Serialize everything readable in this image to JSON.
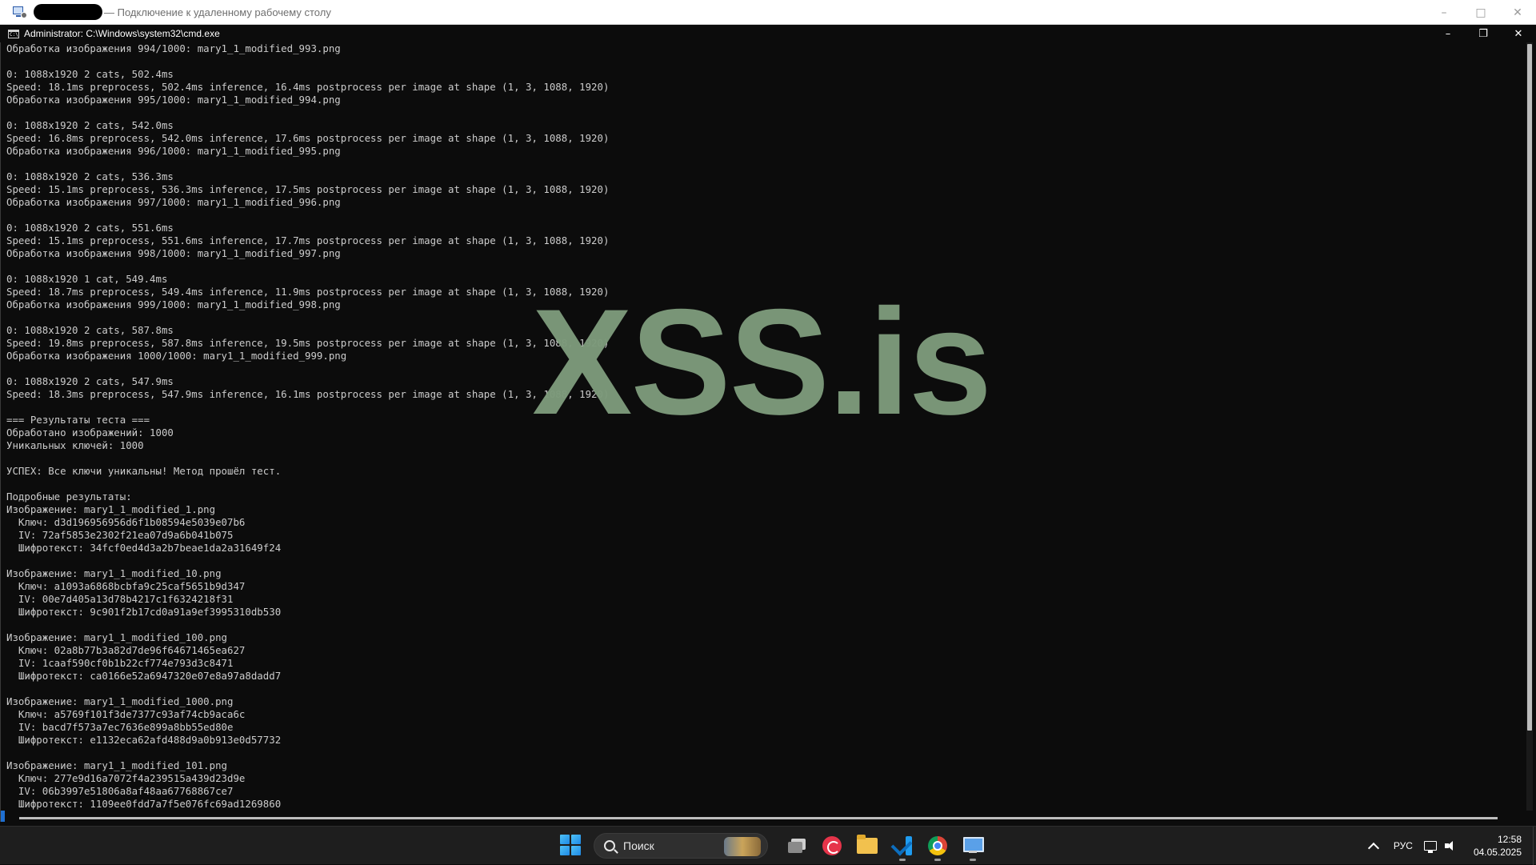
{
  "rdp_window": {
    "title": "— Подключение к удаленному рабочему столу"
  },
  "cmd_window": {
    "title": "Administrator: C:\\Windows\\system32\\cmd.exe"
  },
  "console": {
    "lines": [
      "Обработка изображения 994/1000: mary1_1_modified_993.png",
      "",
      "0: 1088x1920 2 cats, 502.4ms",
      "Speed: 18.1ms preprocess, 502.4ms inference, 16.4ms postprocess per image at shape (1, 3, 1088, 1920)",
      "Обработка изображения 995/1000: mary1_1_modified_994.png",
      "",
      "0: 1088x1920 2 cats, 542.0ms",
      "Speed: 16.8ms preprocess, 542.0ms inference, 17.6ms postprocess per image at shape (1, 3, 1088, 1920)",
      "Обработка изображения 996/1000: mary1_1_modified_995.png",
      "",
      "0: 1088x1920 2 cats, 536.3ms",
      "Speed: 15.1ms preprocess, 536.3ms inference, 17.5ms postprocess per image at shape (1, 3, 1088, 1920)",
      "Обработка изображения 997/1000: mary1_1_modified_996.png",
      "",
      "0: 1088x1920 2 cats, 551.6ms",
      "Speed: 15.1ms preprocess, 551.6ms inference, 17.7ms postprocess per image at shape (1, 3, 1088, 1920)",
      "Обработка изображения 998/1000: mary1_1_modified_997.png",
      "",
      "0: 1088x1920 1 cat, 549.4ms",
      "Speed: 18.7ms preprocess, 549.4ms inference, 11.9ms postprocess per image at shape (1, 3, 1088, 1920)",
      "Обработка изображения 999/1000: mary1_1_modified_998.png",
      "",
      "0: 1088x1920 2 cats, 587.8ms",
      "Speed: 19.8ms preprocess, 587.8ms inference, 19.5ms postprocess per image at shape (1, 3, 1088, 1920)",
      "Обработка изображения 1000/1000: mary1_1_modified_999.png",
      "",
      "0: 1088x1920 2 cats, 547.9ms",
      "Speed: 18.3ms preprocess, 547.9ms inference, 16.1ms postprocess per image at shape (1, 3, 1088, 1920)",
      "",
      "=== Результаты теста ===",
      "Обработано изображений: 1000",
      "Уникальных ключей: 1000",
      "",
      "УСПЕХ: Все ключи уникальны! Метод прошёл тест.",
      "",
      "Подробные результаты:",
      "Изображение: mary1_1_modified_1.png",
      "  Ключ: d3d196956956d6f1b08594e5039e07b6",
      "  IV: 72af5853e2302f21ea07d9a6b041b075",
      "  Шифротекст: 34fcf0ed4d3a2b7beae1da2a31649f24",
      "",
      "Изображение: mary1_1_modified_10.png",
      "  Ключ: a1093a6868bcbfa9c25caf5651b9d347",
      "  IV: 00e7d405a13d78b4217c1f6324218f31",
      "  Шифротекст: 9c901f2b17cd0a91a9ef3995310db530",
      "",
      "Изображение: mary1_1_modified_100.png",
      "  Ключ: 02a8b77b3a82d7de96f64671465ea627",
      "  IV: 1caaf590cf0b1b22cf774e793d3c8471",
      "  Шифротекст: ca0166e52a6947320e07e8a97a8dadd7",
      "",
      "Изображение: mary1_1_modified_1000.png",
      "  Ключ: a5769f101f3de7377c93af74cb9aca6c",
      "  IV: bacd7f573a7ec7636e899a8bb55ed80e",
      "  Шифротекст: e1132eca62afd488d9a0b913e0d57732",
      "",
      "Изображение: mary1_1_modified_101.png",
      "  Ключ: 277e9d16a7072f4a239515a439d23d9e",
      "  IV: 06b3997e51806a8af48aa67768867ce7",
      "  Шифротекст: 1109ee0fdd7a7f5e076fc69ad1269860"
    ]
  },
  "watermark": {
    "text": "XSS.is"
  },
  "taskbar": {
    "search_label": "Поиск",
    "language": "РУС",
    "time": "12:58",
    "date": "04.05.2025"
  },
  "colors": {
    "console_bg": "#0c0c0c",
    "console_text": "#cccccc",
    "watermark": "#7d9a7b",
    "taskbar_bg": "#1e1e1e"
  }
}
